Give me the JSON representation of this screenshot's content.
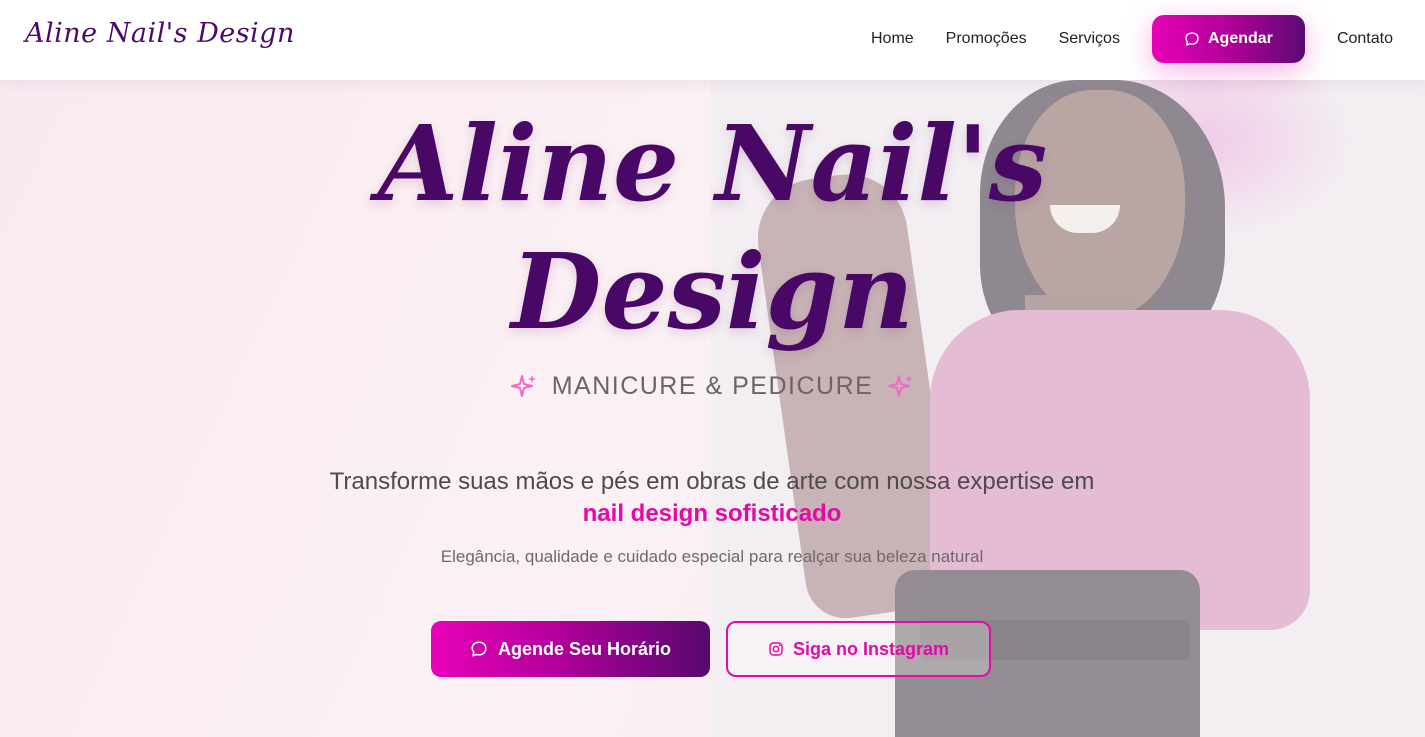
{
  "nav": {
    "logo": "Aline Nail's Design",
    "links": [
      "Home",
      "Promoções",
      "Serviços"
    ],
    "cta_label": "Agendar",
    "contact": "Contato"
  },
  "hero": {
    "title_line1": "Aline Nail's",
    "title_line2": "Design",
    "subtitle": "MANICURE & PEDICURE",
    "description_part1": "Transforme suas mãos e pés em obras de arte com nossa expertise em ",
    "description_highlight": "nail design sofisticado",
    "tagline": "Elegância, qualidade e cuidado especial para realçar sua beleza natural",
    "primary_button": "Agende Seu Horário",
    "secondary_button": "Siga no Instagram"
  },
  "icons": {
    "nav_cta": "chat-bubble-icon",
    "sparkles": "sparkle-icon",
    "primary_button": "chat-bubble-icon",
    "secondary_button": "instagram-icon"
  },
  "colors": {
    "brand_purple": "#4a0866",
    "brand_pink": "#e40aa8",
    "gradient_start": "#e802b8",
    "gradient_end": "#56086e"
  }
}
